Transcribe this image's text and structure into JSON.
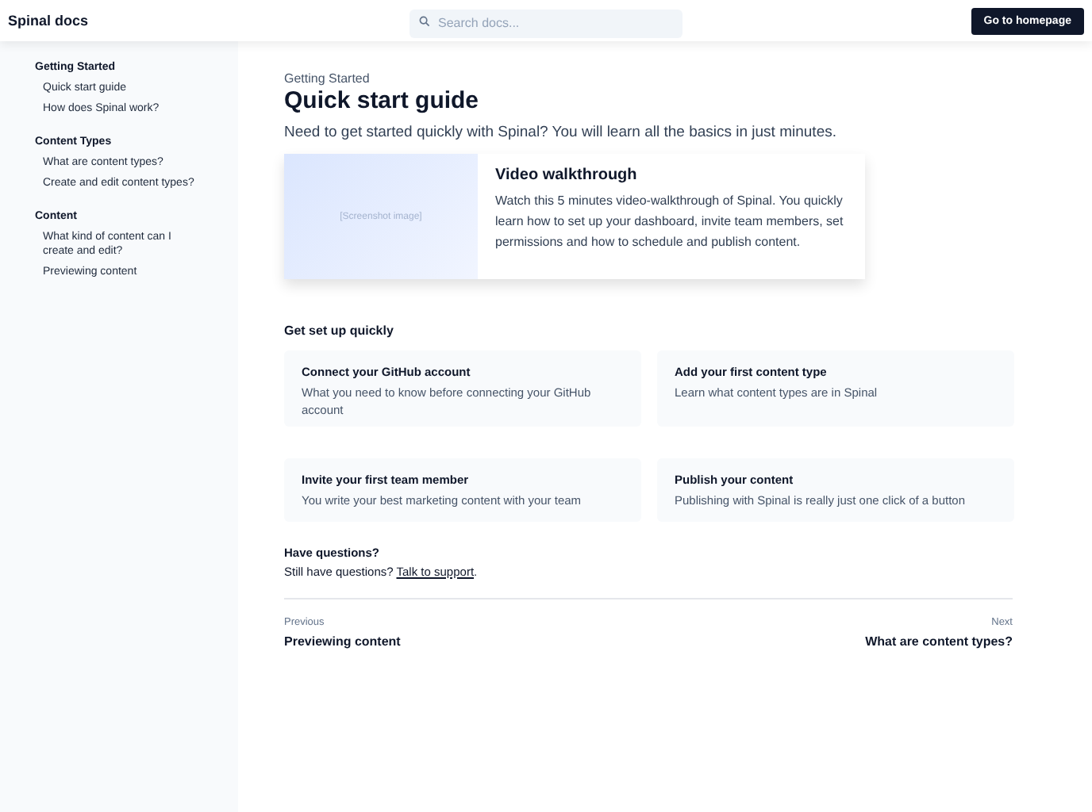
{
  "header": {
    "logo": "Spinal docs",
    "search": {
      "placeholder": "Search docs..."
    },
    "button": "Go to homepage"
  },
  "sidebar": {
    "sections": [
      {
        "title": "Getting Started",
        "items": [
          "Quick start guide",
          "How does Spinal work?"
        ]
      },
      {
        "title": "Content Types",
        "items": [
          "What are content types?",
          "Create and edit content types?"
        ]
      },
      {
        "title": "Content",
        "items": [
          "What kind of content can I create and edit?",
          "Previewing content"
        ]
      }
    ]
  },
  "page": {
    "eyebrow": "Getting Started",
    "title": "Quick start guide",
    "lead": "Need to get started quickly with Spinal? You will learn all the basics in just minutes.",
    "video": {
      "image_label": "[Screenshot image]",
      "title": "Video walkthrough",
      "text": "Watch this 5 minutes video-walkthrough of Spinal. You quickly learn how to set up your dashboard, invite team members, set permissions and how to schedule and publish content."
    },
    "setup": {
      "title": "Get set up quickly",
      "cards": [
        {
          "title": "Connect your GitHub account",
          "text": "What you need to know before connecting your GitHub account"
        },
        {
          "title": "Add your first content type",
          "text": "Learn what content types are in Spinal"
        },
        {
          "title": "Invite your first team member",
          "text": "You write your best marketing content with your team"
        },
        {
          "title": "Publish your content",
          "text": "Publishing with Spinal is really just one click of a button"
        }
      ]
    },
    "questions": {
      "title": "Have questions?",
      "text": "Still have questions?",
      "link": "Talk to support",
      "after": "."
    },
    "pager": {
      "prev_label": "Previous",
      "prev": "Previewing content",
      "next_label": "Next",
      "next": "What are content types?"
    }
  }
}
